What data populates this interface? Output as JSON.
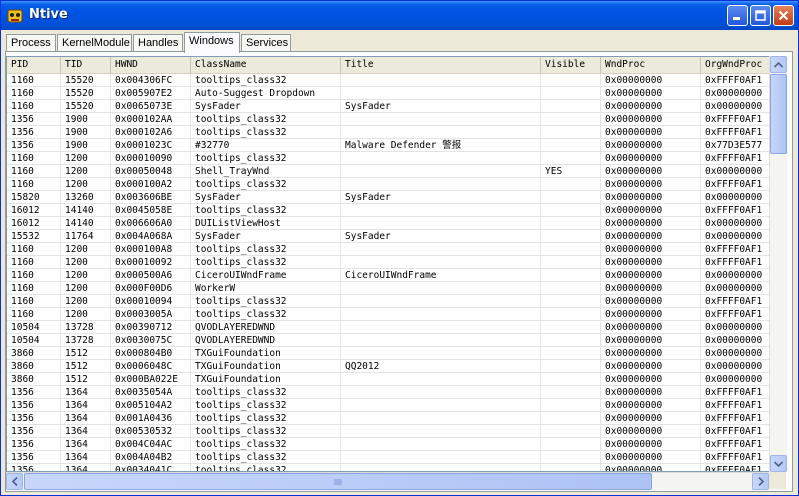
{
  "window": {
    "title": "Ntive",
    "minimize_label": "_",
    "maximize_label": "□",
    "close_label": "×"
  },
  "tabs": [
    {
      "label": "Process",
      "active": false
    },
    {
      "label": "KernelModule",
      "active": false
    },
    {
      "label": "Handles",
      "active": false
    },
    {
      "label": "Windows",
      "active": true
    },
    {
      "label": "Services",
      "active": false
    }
  ],
  "table": {
    "columns": [
      "PID",
      "TID",
      "HWND",
      "ClassName",
      "Title",
      "Visible",
      "WndProc",
      "OrgWndProc"
    ],
    "rows": [
      [
        "1160",
        "15520",
        "0x004306FC",
        "tooltips_class32",
        "",
        "",
        "0x00000000",
        "0xFFFF0AF1"
      ],
      [
        "1160",
        "15520",
        "0x005907E2",
        "Auto-Suggest Dropdown",
        "",
        "",
        "0x00000000",
        "0x00000000"
      ],
      [
        "1160",
        "15520",
        "0x0065073E",
        "SysFader",
        "SysFader",
        "",
        "0x00000000",
        "0x00000000"
      ],
      [
        "1356",
        "1900",
        "0x000102AA",
        "tooltips_class32",
        "",
        "",
        "0x00000000",
        "0xFFFF0AF1"
      ],
      [
        "1356",
        "1900",
        "0x000102A6",
        "tooltips_class32",
        "",
        "",
        "0x00000000",
        "0xFFFF0AF1"
      ],
      [
        "1356",
        "1900",
        "0x0001023C",
        "#32770",
        "Malware Defender 警报",
        "",
        "0x00000000",
        "0x77D3E577"
      ],
      [
        "1160",
        "1200",
        "0x00010090",
        "tooltips_class32",
        "",
        "",
        "0x00000000",
        "0xFFFF0AF1"
      ],
      [
        "1160",
        "1200",
        "0x00050048",
        "Shell_TrayWnd",
        "",
        "YES",
        "0x00000000",
        "0x00000000"
      ],
      [
        "1160",
        "1200",
        "0x000100A2",
        "tooltips_class32",
        "",
        "",
        "0x00000000",
        "0xFFFF0AF1"
      ],
      [
        "15820",
        "13260",
        "0x003606BE",
        "SysFader",
        "SysFader",
        "",
        "0x00000000",
        "0x00000000"
      ],
      [
        "16012",
        "14140",
        "0x0045058E",
        "tooltips_class32",
        "",
        "",
        "0x00000000",
        "0xFFFF0AF1"
      ],
      [
        "16012",
        "14140",
        "0x006606A0",
        "DUIListViewHost",
        "",
        "",
        "0x00000000",
        "0x00000000"
      ],
      [
        "15532",
        "11764",
        "0x004A068A",
        "SysFader",
        "SysFader",
        "",
        "0x00000000",
        "0x00000000"
      ],
      [
        "1160",
        "1200",
        "0x000100A8",
        "tooltips_class32",
        "",
        "",
        "0x00000000",
        "0xFFFF0AF1"
      ],
      [
        "1160",
        "1200",
        "0x00010092",
        "tooltips_class32",
        "",
        "",
        "0x00000000",
        "0xFFFF0AF1"
      ],
      [
        "1160",
        "1200",
        "0x000500A6",
        "CiceroUIWndFrame",
        "CiceroUIWndFrame",
        "",
        "0x00000000",
        "0x00000000"
      ],
      [
        "1160",
        "1200",
        "0x000F00D6",
        "WorkerW",
        "",
        "",
        "0x00000000",
        "0x00000000"
      ],
      [
        "1160",
        "1200",
        "0x00010094",
        "tooltips_class32",
        "",
        "",
        "0x00000000",
        "0xFFFF0AF1"
      ],
      [
        "1160",
        "1200",
        "0x0003005A",
        "tooltips_class32",
        "",
        "",
        "0x00000000",
        "0xFFFF0AF1"
      ],
      [
        "10504",
        "13728",
        "0x00390712",
        "QVODLAYEREDWND",
        "",
        "",
        "0x00000000",
        "0x00000000"
      ],
      [
        "10504",
        "13728",
        "0x0030075C",
        "QVODLAYEREDWND",
        "",
        "",
        "0x00000000",
        "0x00000000"
      ],
      [
        "3860",
        "1512",
        "0x000804B0",
        "TXGuiFoundation",
        "",
        "",
        "0x00000000",
        "0x00000000"
      ],
      [
        "3860",
        "1512",
        "0x0006048C",
        "TXGuiFoundation",
        "QQ2012",
        "",
        "0x00000000",
        "0x00000000"
      ],
      [
        "3860",
        "1512",
        "0x000BA022E",
        "TXGuiFoundation",
        "",
        "",
        "0x00000000",
        "0x00000000"
      ],
      [
        "1356",
        "1364",
        "0x0035054A",
        "tooltips_class32",
        "",
        "",
        "0x00000000",
        "0xFFFF0AF1"
      ],
      [
        "1356",
        "1364",
        "0x005104A2",
        "tooltips_class32",
        "",
        "",
        "0x00000000",
        "0xFFFF0AF1"
      ],
      [
        "1356",
        "1364",
        "0x001A0436",
        "tooltips_class32",
        "",
        "",
        "0x00000000",
        "0xFFFF0AF1"
      ],
      [
        "1356",
        "1364",
        "0x00530532",
        "tooltips_class32",
        "",
        "",
        "0x00000000",
        "0xFFFF0AF1"
      ],
      [
        "1356",
        "1364",
        "0x004C04AC",
        "tooltips_class32",
        "",
        "",
        "0x00000000",
        "0xFFFF0AF1"
      ],
      [
        "1356",
        "1364",
        "0x004A04B2",
        "tooltips_class32",
        "",
        "",
        "0x00000000",
        "0xFFFF0AF1"
      ],
      [
        "1356",
        "1364",
        "0x0034041C",
        "tooltips_class32",
        "",
        "",
        "0x00000000",
        "0xFFFF0AF1"
      ]
    ]
  },
  "icons": {
    "app": "app-icon",
    "scroll_up": "arrow-up-icon",
    "scroll_down": "arrow-down-icon",
    "scroll_left": "arrow-left-icon",
    "scroll_right": "arrow-right-icon"
  },
  "colors": {
    "titlebar": "#0054e3",
    "window_bg": "#ece9d8",
    "close_button": "#c13b14"
  }
}
